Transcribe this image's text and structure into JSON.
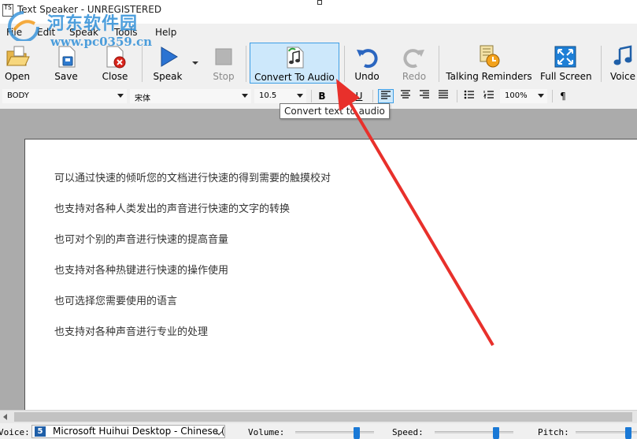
{
  "window": {
    "title": "Text Speaker - UNREGISTERED",
    "app_icon_text": "TS"
  },
  "watermark": {
    "site_name": "河东软件园",
    "url": "www.pc0359.cn"
  },
  "menu": {
    "items": [
      "File",
      "Edit",
      "Speak",
      "Tools",
      "Help"
    ]
  },
  "toolbar": {
    "open": "Open",
    "save": "Save",
    "close": "Close",
    "speak": "Speak",
    "stop": "Stop",
    "convert": "Convert To Audio",
    "undo": "Undo",
    "redo": "Redo",
    "reminders": "Talking Reminders",
    "fullscreen": "Full Screen",
    "voice": "Voice"
  },
  "format": {
    "style": "BODY",
    "font": "宋体",
    "size": "10.5",
    "bold": "B",
    "italic": "I",
    "underline": "U",
    "zoom": "100%",
    "paragraph": "¶"
  },
  "tooltip": {
    "text": "Convert text to audio"
  },
  "document": {
    "lines": [
      "可以通过快速的倾听您的文档进行快速的得到需要的触摸校对",
      "也支持对各种人类发出的声音进行快速的文字的转换",
      "也可对个别的声音进行快速的提高音量",
      "也支持对各种热键进行快速的操作使用",
      "也可选择您需要使用的语言",
      "也支持对各种声音进行专业的处理"
    ]
  },
  "status": {
    "voice_label": "Voice:",
    "voice_value": "Microsoft Huihui Desktop - Chinese (",
    "volume_label": "Volume:",
    "speed_label": "Speed:",
    "pitch_label": "Pitch:",
    "volume_level": 0.8,
    "speed_level": 0.8,
    "pitch_level": 0.9
  },
  "colors": {
    "accent": "#3d9ee5",
    "annotation_arrow": "#e8302b",
    "watermark": "#2f8fd8"
  }
}
